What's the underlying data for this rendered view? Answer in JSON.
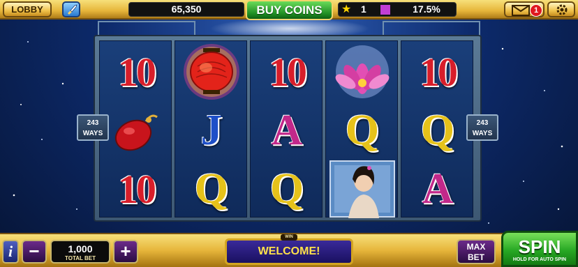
{
  "topbar": {
    "lobby_label": "LOBBY",
    "coins": "65,350",
    "buy_coins_label": "BUY COINS",
    "level": "1",
    "xp_percent": "17.5%",
    "mail_badge": "1"
  },
  "reels": [
    [
      "10",
      "red-pouch",
      "10"
    ],
    [
      "red-lantern",
      "J",
      "Q"
    ],
    [
      "10",
      "A",
      "Q"
    ],
    [
      "pink-lotus",
      "Q",
      "lady-wild"
    ],
    [
      "10",
      "Q",
      "A"
    ]
  ],
  "ways_left": [
    "243",
    "WAYS"
  ],
  "ways_right": [
    "243",
    "WAYS"
  ],
  "bottombar": {
    "info_label": "i",
    "minus_label": "−",
    "bet_value": "1,000",
    "bet_label": "TOTAL BET",
    "plus_label": "+",
    "win_label": "WIN",
    "message": "WELCOME!",
    "maxbet_line1": "MAX",
    "maxbet_line2": "BET",
    "spin_label": "SPIN",
    "spin_sub": "HOLD FOR AUTO SPIN"
  },
  "colors": {
    "gold": "#e6b53a",
    "green": "#27a824",
    "ten_red": "#d81e2a",
    "q_gold": "#e6c21a",
    "a_magenta": "#c2288a",
    "j_blue": "#1e4fc8"
  }
}
